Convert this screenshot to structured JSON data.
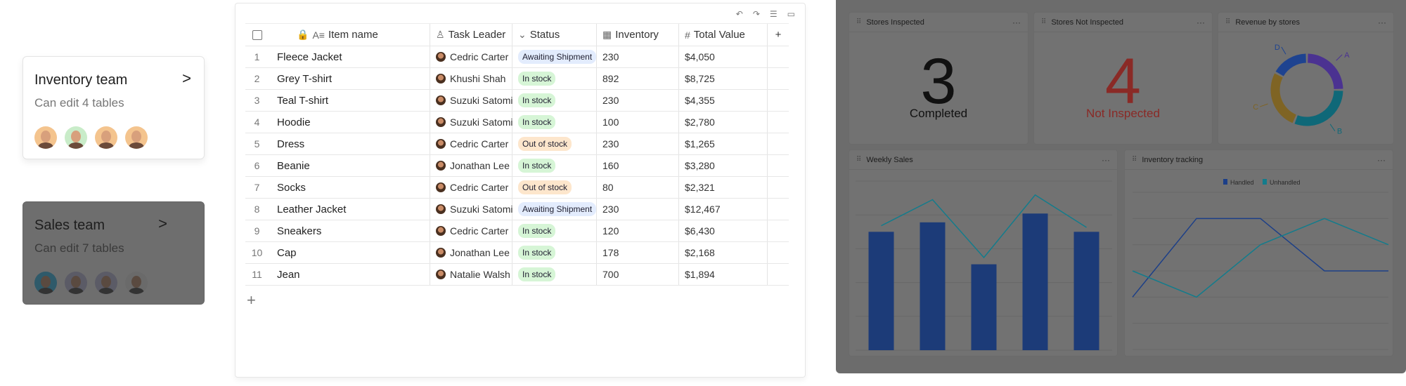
{
  "teams": [
    {
      "title": "Inventory team",
      "subtitle": "Can edit 4 tables",
      "avatars": [
        "#f4c48e",
        "#c9ecc9",
        "#f4c48e",
        "#f4c48e"
      ]
    },
    {
      "title": "Sales team",
      "subtitle": "Can edit 7 tables",
      "avatars": [
        "#2f5a6a",
        "#5b5b66",
        "#5b5b66",
        "#6a6a6a"
      ]
    }
  ],
  "table": {
    "columns": [
      "Item name",
      "Task Leader",
      "Status",
      "Inventory",
      "Total Value"
    ],
    "column_icons": [
      "text-icon",
      "person-icon",
      "status-icon",
      "calendar-icon",
      "hash-icon"
    ],
    "rows": [
      {
        "n": "1",
        "item": "Fleece Jacket",
        "leader": "Cedric Carter",
        "status": "Awaiting Shipment",
        "inv": "230",
        "total": "$4,050"
      },
      {
        "n": "2",
        "item": "Grey T-shirt",
        "leader": "Khushi Shah",
        "status": "In stock",
        "inv": "892",
        "total": "$8,725"
      },
      {
        "n": "3",
        "item": "Teal T-shirt",
        "leader": "Suzuki Satomi",
        "status": "In stock",
        "inv": "230",
        "total": "$4,355"
      },
      {
        "n": "4",
        "item": "Hoodie",
        "leader": "Suzuki Satomi",
        "status": "In stock",
        "inv": "100",
        "total": "$2,780"
      },
      {
        "n": "5",
        "item": "Dress",
        "leader": "Cedric Carter",
        "status": "Out of stock",
        "inv": "230",
        "total": "$1,265"
      },
      {
        "n": "6",
        "item": "Beanie",
        "leader": "Jonathan Lee",
        "status": "In stock",
        "inv": "160",
        "total": "$3,280"
      },
      {
        "n": "7",
        "item": "Socks",
        "leader": "Cedric Carter",
        "status": "Out of stock",
        "inv": "80",
        "total": "$2,321"
      },
      {
        "n": "8",
        "item": "Leather Jacket",
        "leader": "Suzuki Satomi",
        "status": "Awaiting Shipment",
        "inv": "230",
        "total": "$12,467"
      },
      {
        "n": "9",
        "item": "Sneakers",
        "leader": "Cedric Carter",
        "status": "In stock",
        "inv": "120",
        "total": "$6,430"
      },
      {
        "n": "10",
        "item": "Cap",
        "leader": "Jonathan Lee",
        "status": "In stock",
        "inv": "178",
        "total": "$2,168"
      },
      {
        "n": "11",
        "item": "Jean",
        "leader": "Natalie Walsh",
        "status": "In stock",
        "inv": "700",
        "total": "$1,894"
      }
    ],
    "status_colors": {
      "Awaiting Shipment": "#e3ecfd",
      "In stock": "#d6f5d6",
      "Out of stock": "#fde6cc"
    }
  },
  "dashboard": {
    "stores_inspected": {
      "title": "Stores Inspected",
      "value": "3",
      "label": "Completed"
    },
    "stores_not_inspected": {
      "title": "Stores Not Inspected",
      "value": "4",
      "label": "Not Inspected",
      "color": "#8a2a26"
    },
    "revenue": {
      "title": "Revenue by stores"
    },
    "weekly": {
      "title": "Weekly Sales"
    },
    "tracking": {
      "title": "Inventory tracking"
    }
  },
  "chart_data": [
    {
      "type": "pie",
      "title": "Revenue by stores",
      "categories": [
        "A",
        "B",
        "C",
        "D"
      ],
      "values": [
        25,
        31,
        27,
        17
      ],
      "colors": [
        "#4b3291",
        "#0f6878",
        "#7f6424",
        "#1e4390"
      ]
    },
    {
      "type": "bar",
      "title": "Weekly Sales",
      "ylim": [
        0,
        5
      ],
      "grid": true,
      "series": [
        {
          "type": "bar",
          "values": [
            3.5,
            3.78,
            2.54,
            4.04,
            3.5
          ],
          "color": "#1c3b78"
        },
        {
          "type": "line",
          "values": [
            3.68,
            4.45,
            2.74,
            4.59,
            3.63
          ],
          "color": "#137c8c"
        }
      ]
    },
    {
      "type": "line",
      "title": "Inventory tracking",
      "ylim": [
        0,
        6
      ],
      "grid": true,
      "legend": "top",
      "series": [
        {
          "name": "Handled",
          "values": [
            2,
            5,
            5,
            3,
            3
          ],
          "color": "#1c3f88"
        },
        {
          "name": "Unhandled",
          "values": [
            3,
            2,
            4,
            5,
            4
          ],
          "color": "#137c8c"
        }
      ]
    }
  ]
}
